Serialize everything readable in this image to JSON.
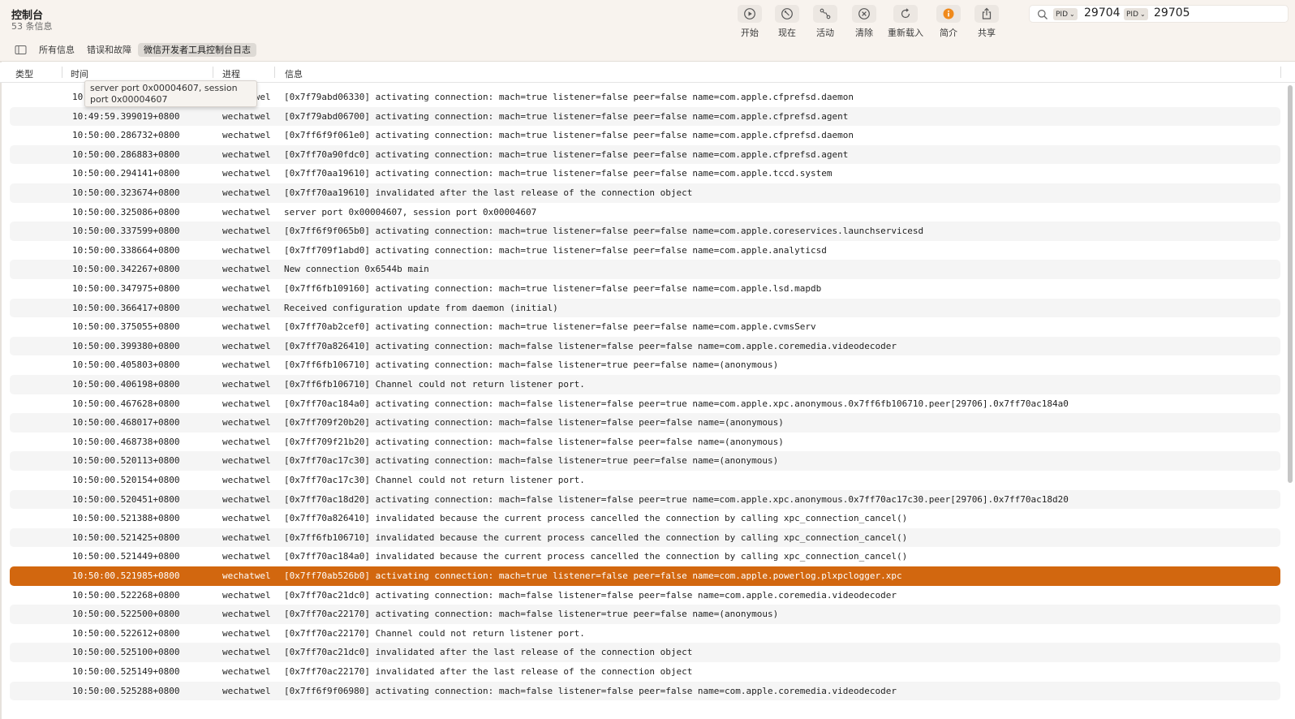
{
  "app": {
    "title": "控制台",
    "subtitle": "53 条信息"
  },
  "toolbar": {
    "start": "开始",
    "now": "现在",
    "activity": "活动",
    "clear": "清除",
    "reload": "重新载入",
    "info": "简介",
    "share": "共享"
  },
  "search": {
    "filters": [
      {
        "field": "PID",
        "value": "29704"
      },
      {
        "field": "PID",
        "value": "29705"
      }
    ]
  },
  "filter_tabs": [
    "所有信息",
    "错误和故障",
    "微信开发者工具控制台日志"
  ],
  "columns": {
    "type": "类型",
    "time": "时间",
    "process": "进程",
    "message": "信息"
  },
  "tooltip": "server port 0x00004607, session port 0x00004607",
  "colors": {
    "accent": "#d2670f",
    "info_icon": "#f08a1c"
  },
  "rows": [
    {
      "time": "10:49:59.398822+0800",
      "process": "wechatwel",
      "message": "[0x7f79abd06330] activating connection: mach=true listener=false peer=false name=com.apple.cfprefsd.daemon"
    },
    {
      "time": "10:49:59.399019+0800",
      "process": "wechatwel",
      "message": "[0x7f79abd06700] activating connection: mach=true listener=false peer=false name=com.apple.cfprefsd.agent"
    },
    {
      "time": "10:50:00.286732+0800",
      "process": "wechatwel",
      "message": "[0x7ff6f9f061e0] activating connection: mach=true listener=false peer=false name=com.apple.cfprefsd.daemon"
    },
    {
      "time": "10:50:00.286883+0800",
      "process": "wechatwel",
      "message": "[0x7ff70a90fdc0] activating connection: mach=true listener=false peer=false name=com.apple.cfprefsd.agent"
    },
    {
      "time": "10:50:00.294141+0800",
      "process": "wechatwel",
      "message": "[0x7ff70aa19610] activating connection: mach=true listener=false peer=false name=com.apple.tccd.system"
    },
    {
      "time": "10:50:00.323674+0800",
      "process": "wechatwel",
      "message": "[0x7ff70aa19610] invalidated after the last release of the connection object"
    },
    {
      "time": "10:50:00.325086+0800",
      "process": "wechatwel",
      "message": "server port 0x00004607, session port 0x00004607"
    },
    {
      "time": "10:50:00.337599+0800",
      "process": "wechatwel",
      "message": "[0x7ff6f9f065b0] activating connection: mach=true listener=false peer=false name=com.apple.coreservices.launchservicesd"
    },
    {
      "time": "10:50:00.338664+0800",
      "process": "wechatwel",
      "message": "[0x7ff709f1abd0] activating connection: mach=true listener=false peer=false name=com.apple.analyticsd"
    },
    {
      "time": "10:50:00.342267+0800",
      "process": "wechatwel",
      "message": "New connection 0x6544b main"
    },
    {
      "time": "10:50:00.347975+0800",
      "process": "wechatwel",
      "message": "[0x7ff6fb109160] activating connection: mach=true listener=false peer=false name=com.apple.lsd.mapdb"
    },
    {
      "time": "10:50:00.366417+0800",
      "process": "wechatwel",
      "message": "Received configuration update from daemon (initial)"
    },
    {
      "time": "10:50:00.375055+0800",
      "process": "wechatwel",
      "message": "[0x7ff70ab2cef0] activating connection: mach=true listener=false peer=false name=com.apple.cvmsServ"
    },
    {
      "time": "10:50:00.399380+0800",
      "process": "wechatwel",
      "message": "[0x7ff70a826410] activating connection: mach=false listener=false peer=false name=com.apple.coremedia.videodecoder"
    },
    {
      "time": "10:50:00.405803+0800",
      "process": "wechatwel",
      "message": "[0x7ff6fb106710] activating connection: mach=false listener=true peer=false name=(anonymous)"
    },
    {
      "time": "10:50:00.406198+0800",
      "process": "wechatwel",
      "message": "[0x7ff6fb106710] Channel could not return listener port."
    },
    {
      "time": "10:50:00.467628+0800",
      "process": "wechatwel",
      "message": "[0x7ff70ac184a0] activating connection: mach=false listener=false peer=true name=com.apple.xpc.anonymous.0x7ff6fb106710.peer[29706].0x7ff70ac184a0"
    },
    {
      "time": "10:50:00.468017+0800",
      "process": "wechatwel",
      "message": "[0x7ff709f20b20] activating connection: mach=false listener=false peer=false name=(anonymous)"
    },
    {
      "time": "10:50:00.468738+0800",
      "process": "wechatwel",
      "message": "[0x7ff709f21b20] activating connection: mach=false listener=false peer=false name=(anonymous)"
    },
    {
      "time": "10:50:00.520113+0800",
      "process": "wechatwel",
      "message": "[0x7ff70ac17c30] activating connection: mach=false listener=true peer=false name=(anonymous)"
    },
    {
      "time": "10:50:00.520154+0800",
      "process": "wechatwel",
      "message": "[0x7ff70ac17c30] Channel could not return listener port."
    },
    {
      "time": "10:50:00.520451+0800",
      "process": "wechatwel",
      "message": "[0x7ff70ac18d20] activating connection: mach=false listener=false peer=true name=com.apple.xpc.anonymous.0x7ff70ac17c30.peer[29706].0x7ff70ac18d20"
    },
    {
      "time": "10:50:00.521388+0800",
      "process": "wechatwel",
      "message": "[0x7ff70a826410] invalidated because the current process cancelled the connection by calling xpc_connection_cancel()"
    },
    {
      "time": "10:50:00.521425+0800",
      "process": "wechatwel",
      "message": "[0x7ff6fb106710] invalidated because the current process cancelled the connection by calling xpc_connection_cancel()"
    },
    {
      "time": "10:50:00.521449+0800",
      "process": "wechatwel",
      "message": "[0x7ff70ac184a0] invalidated because the current process cancelled the connection by calling xpc_connection_cancel()"
    },
    {
      "time": "10:50:00.521985+0800",
      "process": "wechatwel",
      "message": "[0x7ff70ab526b0] activating connection: mach=true listener=false peer=false name=com.apple.powerlog.plxpclogger.xpc",
      "selected": true
    },
    {
      "time": "10:50:00.522268+0800",
      "process": "wechatwel",
      "message": "[0x7ff70ac21dc0] activating connection: mach=false listener=false peer=false name=com.apple.coremedia.videodecoder"
    },
    {
      "time": "10:50:00.522500+0800",
      "process": "wechatwel",
      "message": "[0x7ff70ac22170] activating connection: mach=false listener=true peer=false name=(anonymous)"
    },
    {
      "time": "10:50:00.522612+0800",
      "process": "wechatwel",
      "message": "[0x7ff70ac22170] Channel could not return listener port."
    },
    {
      "time": "10:50:00.525100+0800",
      "process": "wechatwel",
      "message": "[0x7ff70ac21dc0] invalidated after the last release of the connection object"
    },
    {
      "time": "10:50:00.525149+0800",
      "process": "wechatwel",
      "message": "[0x7ff70ac22170] invalidated after the last release of the connection object"
    },
    {
      "time": "10:50:00.525288+0800",
      "process": "wechatwel",
      "message": "[0x7ff6f9f06980] activating connection: mach=false listener=false peer=false name=com.apple.coremedia.videodecoder"
    }
  ]
}
